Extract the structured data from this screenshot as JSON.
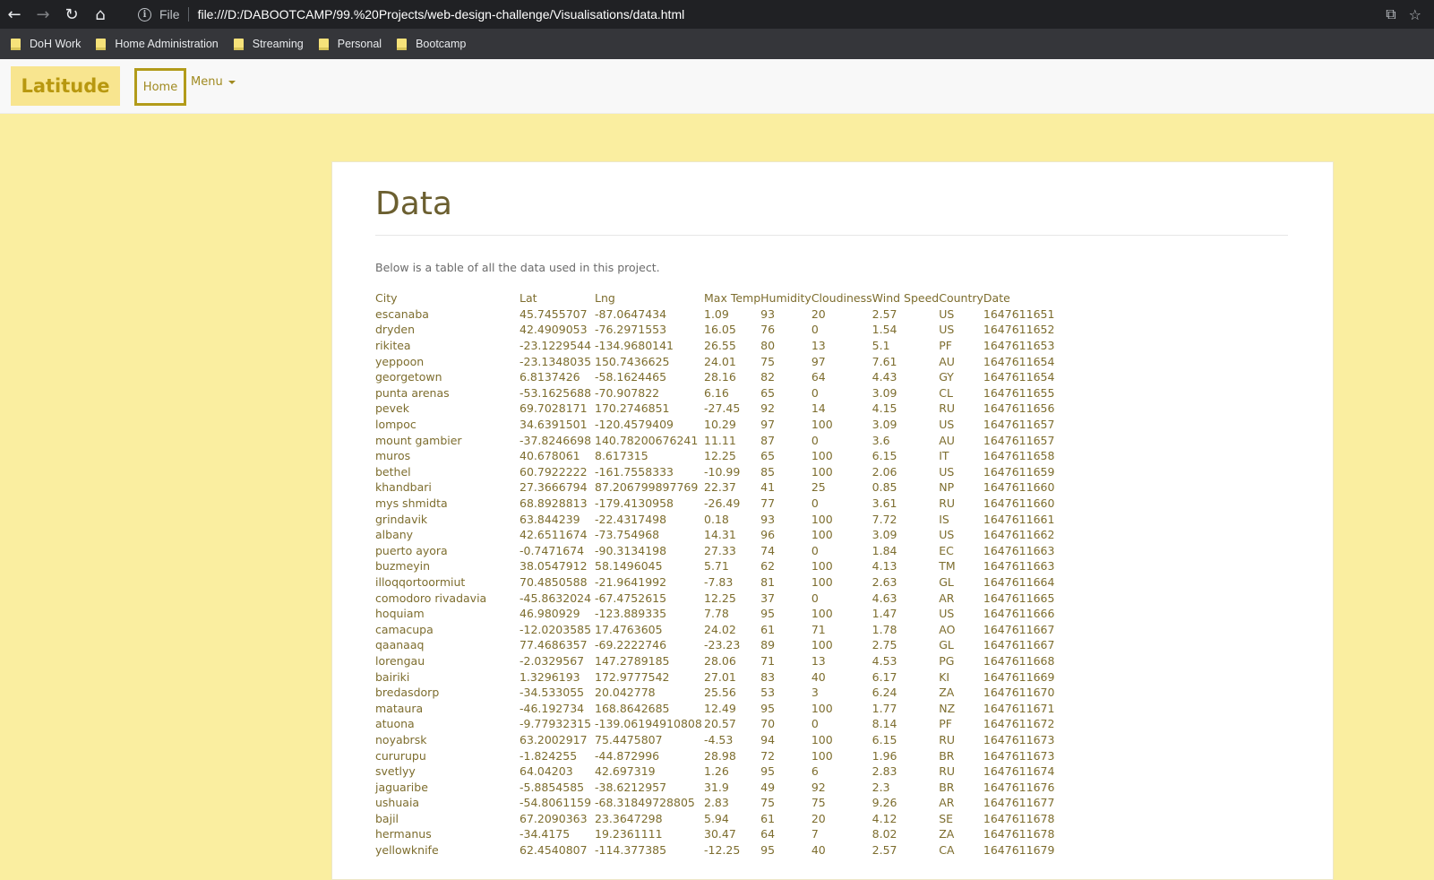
{
  "browser": {
    "file_label": "File",
    "url": "file:///D:/DABOOTCAMP/99.%20Projects/web-design-challenge/Visualisations/data.html",
    "bookmarks": [
      "DoH Work",
      "Home Administration",
      "Streaming",
      "Personal",
      "Bootcamp"
    ]
  },
  "navbar": {
    "brand": "Latitude",
    "home": "Home",
    "menu": "Menu"
  },
  "page": {
    "title": "Data",
    "intro": "Below is a table of all the data used in this project."
  },
  "table": {
    "headers": [
      "City",
      "Lat",
      "Lng",
      "Max Temp",
      "Humidity",
      "Cloudiness",
      "Wind Speed",
      "Country",
      "Date"
    ],
    "rows": [
      [
        "escanaba",
        "45.7455707",
        "-87.0647434",
        "1.09",
        "93",
        "20",
        "2.57",
        "US",
        "1647611651"
      ],
      [
        "dryden",
        "42.4909053",
        "-76.2971553",
        "16.05",
        "76",
        "0",
        "1.54",
        "US",
        "1647611652"
      ],
      [
        "rikitea",
        "-23.1229544",
        "-134.9680141",
        "26.55",
        "80",
        "13",
        "5.1",
        "PF",
        "1647611653"
      ],
      [
        "yeppoon",
        "-23.1348035",
        "150.7436625",
        "24.01",
        "75",
        "97",
        "7.61",
        "AU",
        "1647611654"
      ],
      [
        "georgetown",
        "6.8137426",
        "-58.1624465",
        "28.16",
        "82",
        "64",
        "4.43",
        "GY",
        "1647611654"
      ],
      [
        "punta arenas",
        "-53.1625688",
        "-70.907822",
        "6.16",
        "65",
        "0",
        "3.09",
        "CL",
        "1647611655"
      ],
      [
        "pevek",
        "69.7028171",
        "170.2746851",
        "-27.45",
        "92",
        "14",
        "4.15",
        "RU",
        "1647611656"
      ],
      [
        "lompoc",
        "34.6391501",
        "-120.4579409",
        "10.29",
        "97",
        "100",
        "3.09",
        "US",
        "1647611657"
      ],
      [
        "mount gambier",
        "-37.8246698",
        "140.78200676241",
        "11.11",
        "87",
        "0",
        "3.6",
        "AU",
        "1647611657"
      ],
      [
        "muros",
        "40.678061",
        "8.617315",
        "12.25",
        "65",
        "100",
        "6.15",
        "IT",
        "1647611658"
      ],
      [
        "bethel",
        "60.7922222",
        "-161.7558333",
        "-10.99",
        "85",
        "100",
        "2.06",
        "US",
        "1647611659"
      ],
      [
        "khandbari",
        "27.3666794",
        "87.206799897769",
        "22.37",
        "41",
        "25",
        "0.85",
        "NP",
        "1647611660"
      ],
      [
        "mys shmidta",
        "68.8928813",
        "-179.4130958",
        "-26.49",
        "77",
        "0",
        "3.61",
        "RU",
        "1647611660"
      ],
      [
        "grindavik",
        "63.844239",
        "-22.4317498",
        "0.18",
        "93",
        "100",
        "7.72",
        "IS",
        "1647611661"
      ],
      [
        "albany",
        "42.6511674",
        "-73.754968",
        "14.31",
        "96",
        "100",
        "3.09",
        "US",
        "1647611662"
      ],
      [
        "puerto ayora",
        "-0.7471674",
        "-90.3134198",
        "27.33",
        "74",
        "0",
        "1.84",
        "EC",
        "1647611663"
      ],
      [
        "buzmeyin",
        "38.0547912",
        "58.1496045",
        "5.71",
        "62",
        "100",
        "4.13",
        "TM",
        "1647611663"
      ],
      [
        "illoqqortoormiut",
        "70.4850588",
        "-21.9641992",
        "-7.83",
        "81",
        "100",
        "2.63",
        "GL",
        "1647611664"
      ],
      [
        "comodoro rivadavia",
        "-45.8632024",
        "-67.4752615",
        "12.25",
        "37",
        "0",
        "4.63",
        "AR",
        "1647611665"
      ],
      [
        "hoquiam",
        "46.980929",
        "-123.889335",
        "7.78",
        "95",
        "100",
        "1.47",
        "US",
        "1647611666"
      ],
      [
        "camacupa",
        "-12.0203585",
        "17.4763605",
        "24.02",
        "61",
        "71",
        "1.78",
        "AO",
        "1647611667"
      ],
      [
        "qaanaaq",
        "77.4686357",
        "-69.2222746",
        "-23.23",
        "89",
        "100",
        "2.75",
        "GL",
        "1647611667"
      ],
      [
        "lorengau",
        "-2.0329567",
        "147.2789185",
        "28.06",
        "71",
        "13",
        "4.53",
        "PG",
        "1647611668"
      ],
      [
        "bairiki",
        "1.3296193",
        "172.9777542",
        "27.01",
        "83",
        "40",
        "6.17",
        "KI",
        "1647611669"
      ],
      [
        "bredasdorp",
        "-34.533055",
        "20.042778",
        "25.56",
        "53",
        "3",
        "6.24",
        "ZA",
        "1647611670"
      ],
      [
        "mataura",
        "-46.192734",
        "168.8642685",
        "12.49",
        "95",
        "100",
        "1.77",
        "NZ",
        "1647611671"
      ],
      [
        "atuona",
        "-9.77932315",
        "-139.06194910808",
        "20.57",
        "70",
        "0",
        "8.14",
        "PF",
        "1647611672"
      ],
      [
        "noyabrsk",
        "63.2002917",
        "75.4475807",
        "-4.53",
        "94",
        "100",
        "6.15",
        "RU",
        "1647611673"
      ],
      [
        "cururupu",
        "-1.824255",
        "-44.872996",
        "28.98",
        "72",
        "100",
        "1.96",
        "BR",
        "1647611673"
      ],
      [
        "svetlyy",
        "64.04203",
        "42.697319",
        "1.26",
        "95",
        "6",
        "2.83",
        "RU",
        "1647611674"
      ],
      [
        "jaguaribe",
        "-5.8854585",
        "-38.6212957",
        "31.9",
        "49",
        "92",
        "2.3",
        "BR",
        "1647611676"
      ],
      [
        "ushuaia",
        "-54.8061159",
        "-68.31849728805",
        "2.83",
        "75",
        "75",
        "9.26",
        "AR",
        "1647611677"
      ],
      [
        "bajil",
        "67.2090363",
        "23.3647298",
        "5.94",
        "61",
        "20",
        "4.12",
        "SE",
        "1647611678"
      ],
      [
        "hermanus",
        "-34.4175",
        "19.2361111",
        "30.47",
        "64",
        "7",
        "8.02",
        "ZA",
        "1647611678"
      ],
      [
        "yellowknife",
        "62.4540807",
        "-114.377385",
        "-12.25",
        "95",
        "40",
        "2.57",
        "CA",
        "1647611679"
      ]
    ]
  }
}
